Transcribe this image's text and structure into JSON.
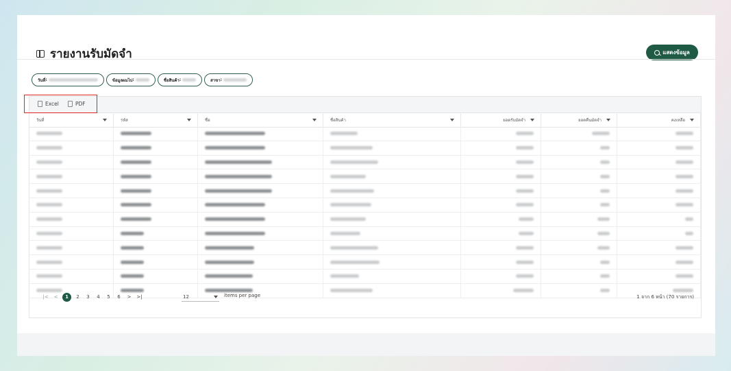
{
  "page": {
    "title": "รายงานรับมัดจำ",
    "show_button": "แสดงข้อมูล"
  },
  "filters": [
    {
      "label": "วันที่",
      "value_width": 72
    },
    {
      "label": "ข้อมูลผมไป",
      "value_width": 20
    },
    {
      "label": "ชื่อสินค้า",
      "value_width": 20
    },
    {
      "label": "สาขา",
      "value_width": 34
    }
  ],
  "toolbar": {
    "excel": "Excel",
    "pdf": "PDF"
  },
  "table": {
    "columns": [
      {
        "label": "วันที่",
        "w": 123,
        "align": "left"
      },
      {
        "label": "รหัส",
        "w": 123,
        "align": "left"
      },
      {
        "label": "ชื่อ",
        "w": 183,
        "align": "left"
      },
      {
        "label": "ชื่อสินค้า",
        "w": 201,
        "align": "left"
      },
      {
        "label": "ยอดรับมัดจำ",
        "w": 117,
        "align": "right"
      },
      {
        "label": "ยอดคืนมัดจำ",
        "w": 111,
        "align": "right"
      },
      {
        "label": "คงเหลือ",
        "w": 122,
        "align": "right"
      }
    ],
    "rows": [
      [
        38,
        45,
        88,
        40,
        26,
        26,
        26
      ],
      [
        38,
        45,
        88,
        62,
        26,
        14,
        26
      ],
      [
        38,
        45,
        98,
        70,
        26,
        14,
        26
      ],
      [
        38,
        45,
        98,
        52,
        26,
        14,
        26
      ],
      [
        38,
        45,
        98,
        64,
        26,
        14,
        26
      ],
      [
        38,
        45,
        88,
        60,
        26,
        14,
        26
      ],
      [
        38,
        45,
        88,
        52,
        22,
        18,
        12
      ],
      [
        38,
        34,
        88,
        44,
        22,
        18,
        12
      ],
      [
        38,
        34,
        72,
        70,
        26,
        18,
        26
      ],
      [
        38,
        34,
        72,
        72,
        26,
        14,
        26
      ],
      [
        38,
        34,
        70,
        42,
        26,
        14,
        26
      ],
      [
        38,
        34,
        70,
        62,
        30,
        14,
        30
      ]
    ]
  },
  "pagination": {
    "first": "|<",
    "prev": "<",
    "pages": [
      "1",
      "2",
      "3",
      "4",
      "5",
      "6"
    ],
    "next": ">",
    "last": ">|",
    "per_page": "12",
    "per_page_label": "items per page",
    "info": "1 จาก 6 หน้า (70 รายการ)"
  }
}
